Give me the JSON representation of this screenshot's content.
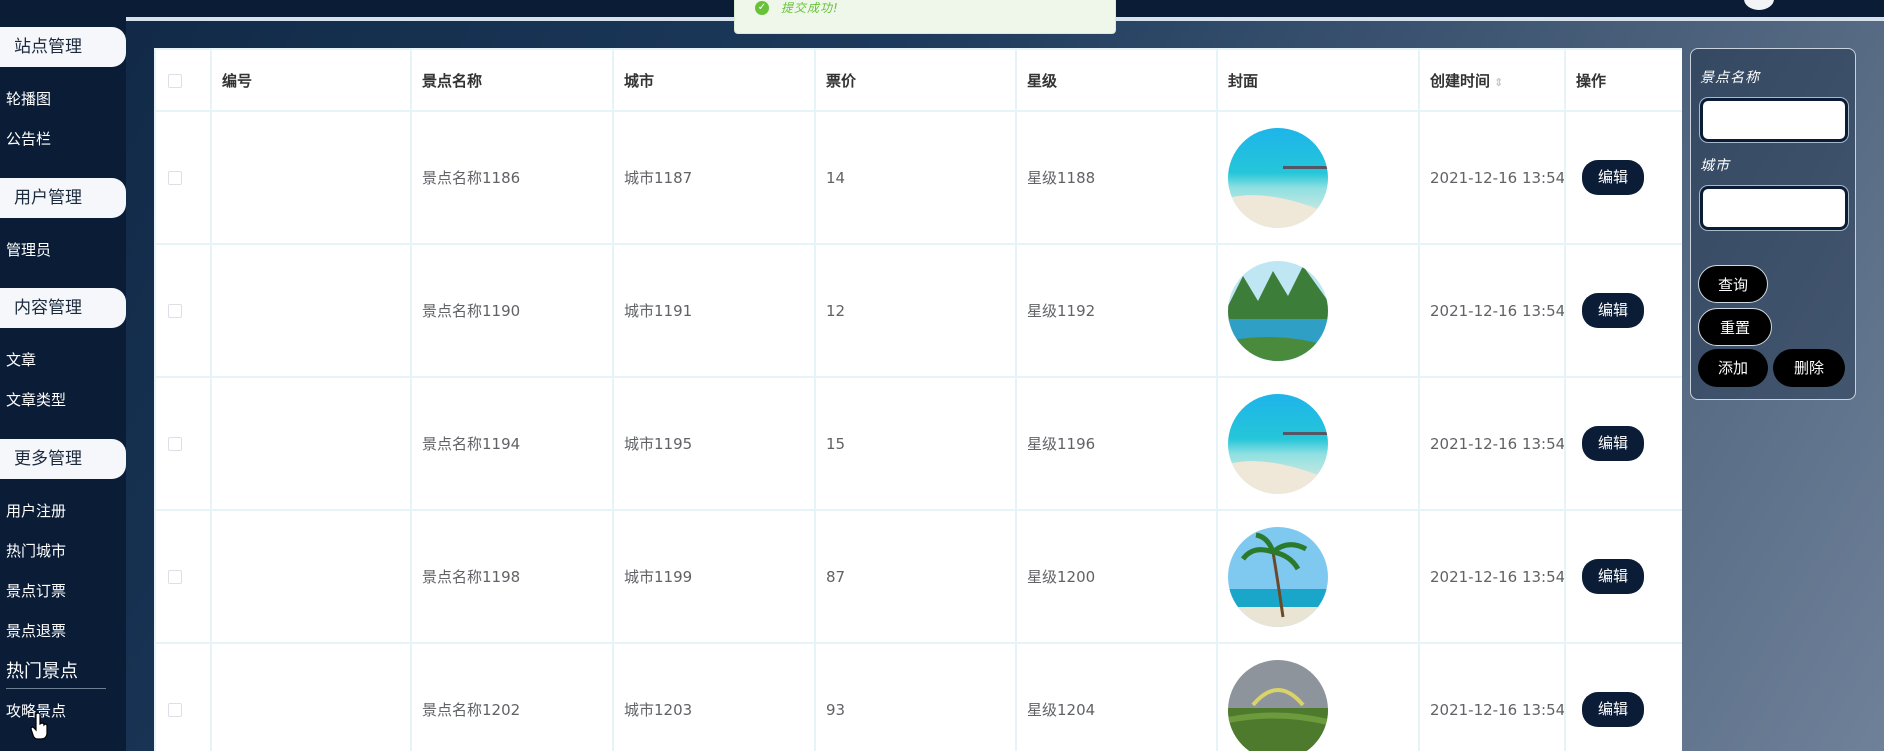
{
  "toast": {
    "message": "提交成功!"
  },
  "sidebar": {
    "groups": [
      {
        "title": "站点管理"
      },
      {
        "title": "用户管理"
      },
      {
        "title": "内容管理"
      },
      {
        "title": "更多管理"
      }
    ],
    "items": {
      "lunbotu": "轮播图",
      "gonggaolan": "公告栏",
      "guanliyuan": "管理员",
      "wenzhang": "文章",
      "wenzhangleixing": "文章类型",
      "yonghuzhuce": "用户注册",
      "remenchengshi": "热门城市",
      "jingdiandingpiao": "景点订票",
      "jingdiantuipiao": "景点退票",
      "remenjingdian": "热门景点",
      "gonglvejingdian": "攻略景点"
    }
  },
  "table": {
    "headers": {
      "id": "编号",
      "name": "景点名称",
      "city": "城市",
      "price": "票价",
      "stars": "星级",
      "cover": "封面",
      "created": "创建时间",
      "actions": "操作"
    },
    "edit_label": "编辑",
    "rows": [
      {
        "id": "",
        "name": "景点名称1186",
        "city": "城市1187",
        "price": "14",
        "stars": "星级1188",
        "cover": "beach-pier",
        "created": "2021-12-16 13:54:"
      },
      {
        "id": "",
        "name": "景点名称1190",
        "city": "城市1191",
        "price": "12",
        "stars": "星级1192",
        "cover": "lake-mountain",
        "created": "2021-12-16 13:54:"
      },
      {
        "id": "",
        "name": "景点名称1194",
        "city": "城市1195",
        "price": "15",
        "stars": "星级1196",
        "cover": "beach-pier",
        "created": "2021-12-16 13:54:"
      },
      {
        "id": "",
        "name": "景点名称1198",
        "city": "城市1199",
        "price": "87",
        "stars": "星级1200",
        "cover": "palm-island",
        "created": "2021-12-16 13:54:"
      },
      {
        "id": "",
        "name": "景点名称1202",
        "city": "城市1203",
        "price": "93",
        "stars": "星级1204",
        "cover": "grass-rainbow",
        "created": "2021-12-16 13:54:"
      }
    ]
  },
  "search": {
    "name_label": "景点名称",
    "city_label": "城市",
    "name_value": "",
    "city_value": "",
    "query_label": "查询",
    "reset_label": "重置",
    "add_label": "添加",
    "delete_label": "删除"
  }
}
